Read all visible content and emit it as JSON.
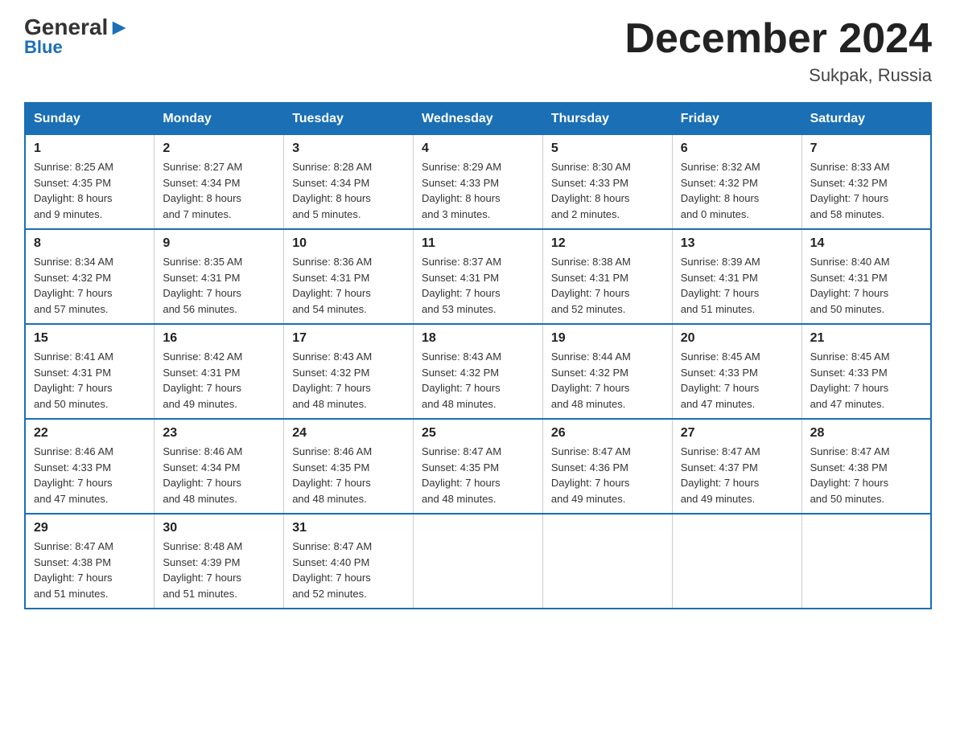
{
  "header": {
    "logo_general": "General",
    "logo_blue": "Blue",
    "month_title": "December 2024",
    "location": "Sukpak, Russia"
  },
  "days_of_week": [
    "Sunday",
    "Monday",
    "Tuesday",
    "Wednesday",
    "Thursday",
    "Friday",
    "Saturday"
  ],
  "weeks": [
    [
      {
        "day": "1",
        "sunrise": "8:25 AM",
        "sunset": "4:35 PM",
        "daylight": "8 hours and 9 minutes."
      },
      {
        "day": "2",
        "sunrise": "8:27 AM",
        "sunset": "4:34 PM",
        "daylight": "8 hours and 7 minutes."
      },
      {
        "day": "3",
        "sunrise": "8:28 AM",
        "sunset": "4:34 PM",
        "daylight": "8 hours and 5 minutes."
      },
      {
        "day": "4",
        "sunrise": "8:29 AM",
        "sunset": "4:33 PM",
        "daylight": "8 hours and 3 minutes."
      },
      {
        "day": "5",
        "sunrise": "8:30 AM",
        "sunset": "4:33 PM",
        "daylight": "8 hours and 2 minutes."
      },
      {
        "day": "6",
        "sunrise": "8:32 AM",
        "sunset": "4:32 PM",
        "daylight": "8 hours and 0 minutes."
      },
      {
        "day": "7",
        "sunrise": "8:33 AM",
        "sunset": "4:32 PM",
        "daylight": "7 hours and 58 minutes."
      }
    ],
    [
      {
        "day": "8",
        "sunrise": "8:34 AM",
        "sunset": "4:32 PM",
        "daylight": "7 hours and 57 minutes."
      },
      {
        "day": "9",
        "sunrise": "8:35 AM",
        "sunset": "4:31 PM",
        "daylight": "7 hours and 56 minutes."
      },
      {
        "day": "10",
        "sunrise": "8:36 AM",
        "sunset": "4:31 PM",
        "daylight": "7 hours and 54 minutes."
      },
      {
        "day": "11",
        "sunrise": "8:37 AM",
        "sunset": "4:31 PM",
        "daylight": "7 hours and 53 minutes."
      },
      {
        "day": "12",
        "sunrise": "8:38 AM",
        "sunset": "4:31 PM",
        "daylight": "7 hours and 52 minutes."
      },
      {
        "day": "13",
        "sunrise": "8:39 AM",
        "sunset": "4:31 PM",
        "daylight": "7 hours and 51 minutes."
      },
      {
        "day": "14",
        "sunrise": "8:40 AM",
        "sunset": "4:31 PM",
        "daylight": "7 hours and 50 minutes."
      }
    ],
    [
      {
        "day": "15",
        "sunrise": "8:41 AM",
        "sunset": "4:31 PM",
        "daylight": "7 hours and 50 minutes."
      },
      {
        "day": "16",
        "sunrise": "8:42 AM",
        "sunset": "4:31 PM",
        "daylight": "7 hours and 49 minutes."
      },
      {
        "day": "17",
        "sunrise": "8:43 AM",
        "sunset": "4:32 PM",
        "daylight": "7 hours and 48 minutes."
      },
      {
        "day": "18",
        "sunrise": "8:43 AM",
        "sunset": "4:32 PM",
        "daylight": "7 hours and 48 minutes."
      },
      {
        "day": "19",
        "sunrise": "8:44 AM",
        "sunset": "4:32 PM",
        "daylight": "7 hours and 48 minutes."
      },
      {
        "day": "20",
        "sunrise": "8:45 AM",
        "sunset": "4:33 PM",
        "daylight": "7 hours and 47 minutes."
      },
      {
        "day": "21",
        "sunrise": "8:45 AM",
        "sunset": "4:33 PM",
        "daylight": "7 hours and 47 minutes."
      }
    ],
    [
      {
        "day": "22",
        "sunrise": "8:46 AM",
        "sunset": "4:33 PM",
        "daylight": "7 hours and 47 minutes."
      },
      {
        "day": "23",
        "sunrise": "8:46 AM",
        "sunset": "4:34 PM",
        "daylight": "7 hours and 48 minutes."
      },
      {
        "day": "24",
        "sunrise": "8:46 AM",
        "sunset": "4:35 PM",
        "daylight": "7 hours and 48 minutes."
      },
      {
        "day": "25",
        "sunrise": "8:47 AM",
        "sunset": "4:35 PM",
        "daylight": "7 hours and 48 minutes."
      },
      {
        "day": "26",
        "sunrise": "8:47 AM",
        "sunset": "4:36 PM",
        "daylight": "7 hours and 49 minutes."
      },
      {
        "day": "27",
        "sunrise": "8:47 AM",
        "sunset": "4:37 PM",
        "daylight": "7 hours and 49 minutes."
      },
      {
        "day": "28",
        "sunrise": "8:47 AM",
        "sunset": "4:38 PM",
        "daylight": "7 hours and 50 minutes."
      }
    ],
    [
      {
        "day": "29",
        "sunrise": "8:47 AM",
        "sunset": "4:38 PM",
        "daylight": "7 hours and 51 minutes."
      },
      {
        "day": "30",
        "sunrise": "8:48 AM",
        "sunset": "4:39 PM",
        "daylight": "7 hours and 51 minutes."
      },
      {
        "day": "31",
        "sunrise": "8:47 AM",
        "sunset": "4:40 PM",
        "daylight": "7 hours and 52 minutes."
      },
      null,
      null,
      null,
      null
    ]
  ],
  "labels": {
    "sunrise": "Sunrise:",
    "sunset": "Sunset:",
    "daylight": "Daylight:"
  }
}
